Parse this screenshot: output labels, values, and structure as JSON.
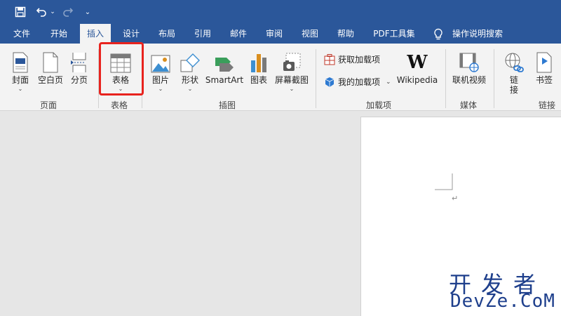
{
  "quick_access": {
    "undo_dropdown": "⌄",
    "customize": "⌄"
  },
  "tabs": [
    {
      "label": "文件"
    },
    {
      "label": "开始"
    },
    {
      "label": "插入"
    },
    {
      "label": "设计"
    },
    {
      "label": "布局"
    },
    {
      "label": "引用"
    },
    {
      "label": "邮件"
    },
    {
      "label": "审阅"
    },
    {
      "label": "视图"
    },
    {
      "label": "帮助"
    },
    {
      "label": "PDF工具集"
    },
    {
      "label": "操作说明搜索"
    }
  ],
  "ribbon": {
    "pages": {
      "cover": "封面",
      "blank": "空白页",
      "break": "分页",
      "group": "页面"
    },
    "tables": {
      "table": "表格",
      "group": "表格"
    },
    "illustrations": {
      "pictures": "图片",
      "shapes": "形状",
      "smartart": "SmartArt",
      "chart": "图表",
      "screenshot": "屏幕截图",
      "group": "插图"
    },
    "addins": {
      "get": "获取加载项",
      "mine": "我的加载项",
      "wikipedia": "Wikipedia",
      "group": "加载项"
    },
    "media": {
      "online_video": "联机视频",
      "group": "媒体"
    },
    "links": {
      "link": "链接",
      "bookmark": "书签",
      "group": "链接"
    },
    "dropdown_glyph": "⌄"
  },
  "document": {
    "paragraph_mark": "↵"
  },
  "watermark": {
    "line1": "开发者",
    "line2": "DevZe.CoM"
  },
  "colors": {
    "brand": "#2b579a",
    "highlight": "#e8231e"
  }
}
